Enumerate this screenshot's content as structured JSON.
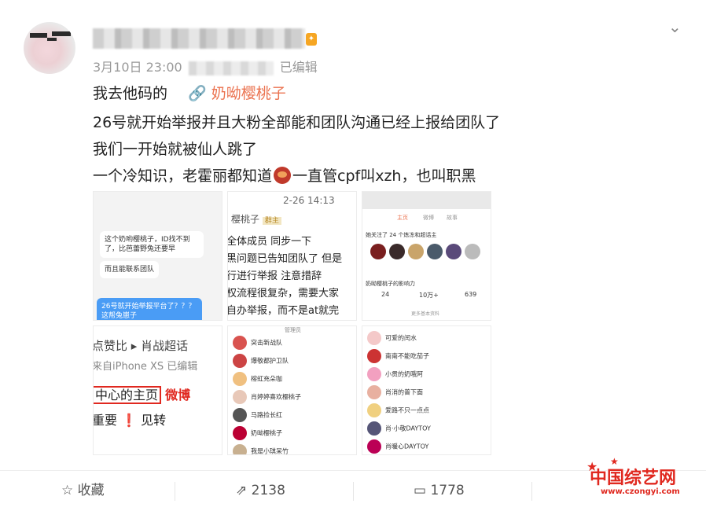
{
  "post": {
    "timestamp": "3月10日 23:00",
    "edited": "已编辑",
    "lines": {
      "l1_text": "我去他码的",
      "l1_mention": "奶呦樱桃子",
      "l2": "26号就开始举报并且大粉全部能和团队沟通已经上报给团队了",
      "l3": "我们一开始就被仙人跳了",
      "l4a": "一个冷知识，老霍丽都知道",
      "l4b": "一直管cpf叫xzh，也叫职黑"
    }
  },
  "images": {
    "tile1": {
      "b1": "这个奶哟樱桃子，ID找不到了，比芭蕾野兔还要早",
      "b2": "而且能联系团队",
      "b3": "26号就开始举报平台了？？？这帮兔崽子"
    },
    "tile2": {
      "time": "2-26 14:13",
      "name": "樱桃子",
      "badge": "群主",
      "l1": "全体成员 同步一下",
      "l2": "黑问题已告知团队了 但是",
      "l3": "行进行举报 注意措辞",
      "l4": "权流程很复杂，需要大家",
      "l5": "自办举报，而不是at就完"
    },
    "tile3": {
      "tabs": [
        "主页",
        "微博",
        "故事"
      ],
      "follow": "她关注了 24 个炼冻和超话主",
      "power": "奶呦樱桃子的影响力",
      "stats": [
        "24",
        "10万+",
        "639"
      ],
      "more": "更多基本资料"
    },
    "tile4": {
      "l1": "点赞比 ▸ 肖战超话",
      "l2": "来自iPhone XS 已编辑",
      "l3a": "中心的主页",
      "l3b": "微博",
      "l4": "重要 ❗ 见转"
    },
    "tile5": {
      "header": "管理员",
      "rows": [
        "突击新战队",
        "爆敬都护卫队",
        "榕虹充朵咖",
        "肖婷婷喜欢樱桃子",
        "马路捡长红",
        "奶呦樱桃子",
        "我是小琪呆竹"
      ]
    },
    "tile6": {
      "rows": [
        "可爱的闰水",
        "南南不能吃茄子",
        "小贯的奶哦阿",
        "肖消的普下面",
        "爱路不只一点点",
        "肖·小敬DAYTOY",
        "肖暖心DAYTOY"
      ]
    }
  },
  "actions": {
    "collect": "收藏",
    "repost": "2138",
    "comment": "1778"
  },
  "watermark": {
    "title": "中国综艺网",
    "url": "www.czongyi.com"
  },
  "colors": {
    "mention": "#eb7350",
    "watermark": "#e0281f"
  }
}
